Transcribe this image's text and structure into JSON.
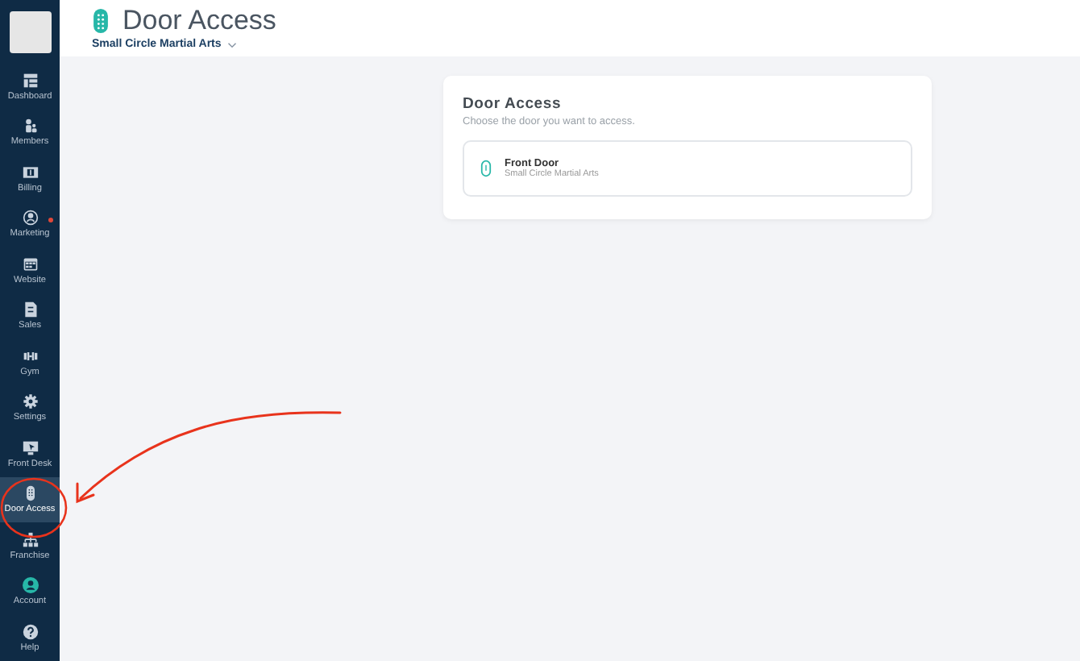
{
  "sidebar": {
    "items": [
      {
        "label": "Dashboard",
        "selected": false,
        "notification": false
      },
      {
        "label": "Members",
        "selected": false,
        "notification": false
      },
      {
        "label": "Billing",
        "selected": false,
        "notification": false
      },
      {
        "label": "Marketing",
        "selected": false,
        "notification": true
      },
      {
        "label": "Website",
        "selected": false,
        "notification": false
      },
      {
        "label": "Sales",
        "selected": false,
        "notification": false
      },
      {
        "label": "Gym",
        "selected": false,
        "notification": false
      },
      {
        "label": "Settings",
        "selected": false,
        "notification": false
      },
      {
        "label": "Front Desk",
        "selected": false,
        "notification": false
      },
      {
        "label": "Door Access",
        "selected": true,
        "notification": false
      },
      {
        "label": "Franchise",
        "selected": false,
        "notification": false
      },
      {
        "label": "Account",
        "selected": false,
        "notification": false
      },
      {
        "label": "Help",
        "selected": false,
        "notification": false
      }
    ]
  },
  "header": {
    "title": "Door Access",
    "location": "Small Circle Martial Arts"
  },
  "card": {
    "title": "Door Access",
    "subtitle": "Choose the door you want to access.",
    "doors": [
      {
        "name": "Front Door",
        "location": "Small Circle Martial Arts"
      }
    ]
  }
}
